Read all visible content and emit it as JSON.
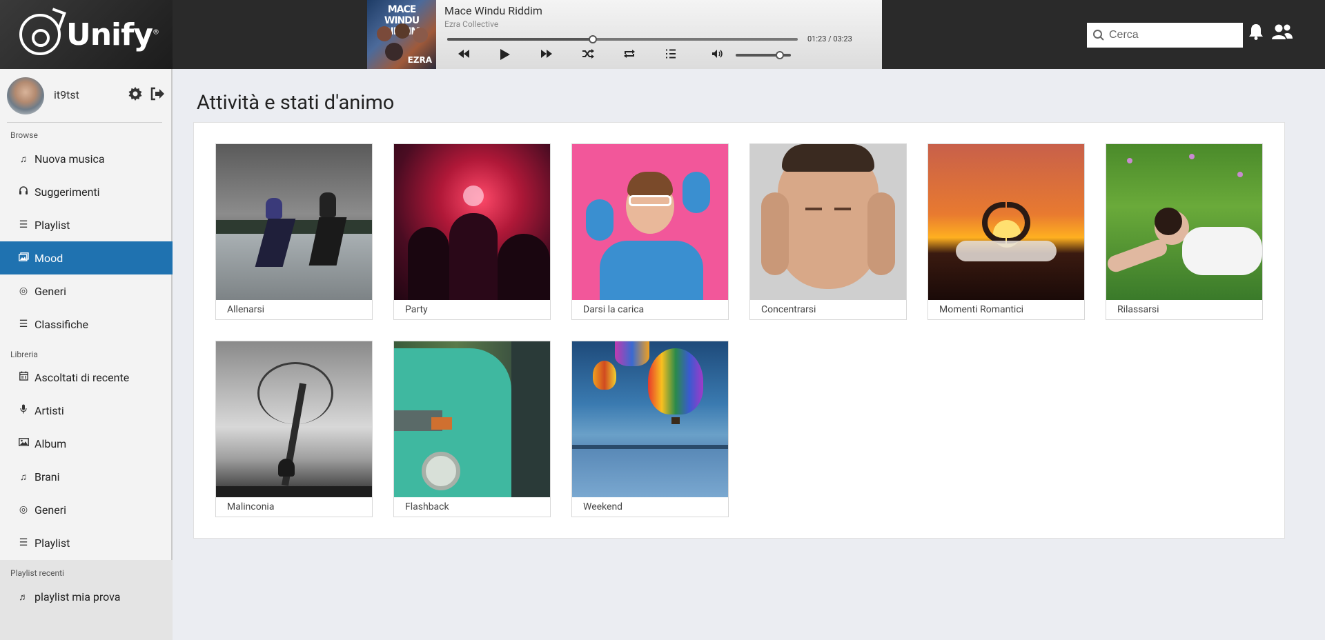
{
  "brand": {
    "name": "Unify",
    "reg": "®"
  },
  "player": {
    "title": "Mace Windu Riddim",
    "artist": "Ezra Collective",
    "cover_text": "MACE WINDU RIDDIM",
    "cover_label": "EZRA",
    "time": "01:23 / 03:23",
    "progress_fraction": 0.415,
    "volume_fraction": 0.8
  },
  "search": {
    "placeholder": "Cerca"
  },
  "user": {
    "name": "it9tst"
  },
  "sidebar": {
    "browse_title": "Browse",
    "browse": [
      {
        "label": "Nuova musica",
        "icon": "music-note-icon"
      },
      {
        "label": "Suggerimenti",
        "icon": "headphones-icon"
      },
      {
        "label": "Playlist",
        "icon": "list-icon"
      },
      {
        "label": "Mood",
        "icon": "images-icon",
        "active": true
      },
      {
        "label": "Generi",
        "icon": "disc-icon"
      },
      {
        "label": "Classifiche",
        "icon": "list-icon"
      }
    ],
    "library_title": "Libreria",
    "library": [
      {
        "label": "Ascoltati di recente",
        "icon": "calendar-icon"
      },
      {
        "label": "Artisti",
        "icon": "microphone-icon"
      },
      {
        "label": "Album",
        "icon": "image-icon"
      },
      {
        "label": "Brani",
        "icon": "music-note-icon"
      },
      {
        "label": "Generi",
        "icon": "disc-icon"
      },
      {
        "label": "Playlist",
        "icon": "list-icon"
      }
    ],
    "recent_title": "Playlist recenti",
    "recent": [
      {
        "label": "playlist mia prova",
        "icon": "music-icon"
      }
    ]
  },
  "main": {
    "title": "Attività e stati d'animo",
    "moods": [
      {
        "label": "Allenarsi"
      },
      {
        "label": "Party"
      },
      {
        "label": "Darsi la carica"
      },
      {
        "label": "Concentrarsi"
      },
      {
        "label": "Momenti Romantici"
      },
      {
        "label": "Rilassarsi"
      },
      {
        "label": "Malinconia"
      },
      {
        "label": "Flashback"
      },
      {
        "label": "Weekend"
      }
    ]
  },
  "colors": {
    "accent": "#1f72b0",
    "topbar": "#2a2a2a"
  }
}
